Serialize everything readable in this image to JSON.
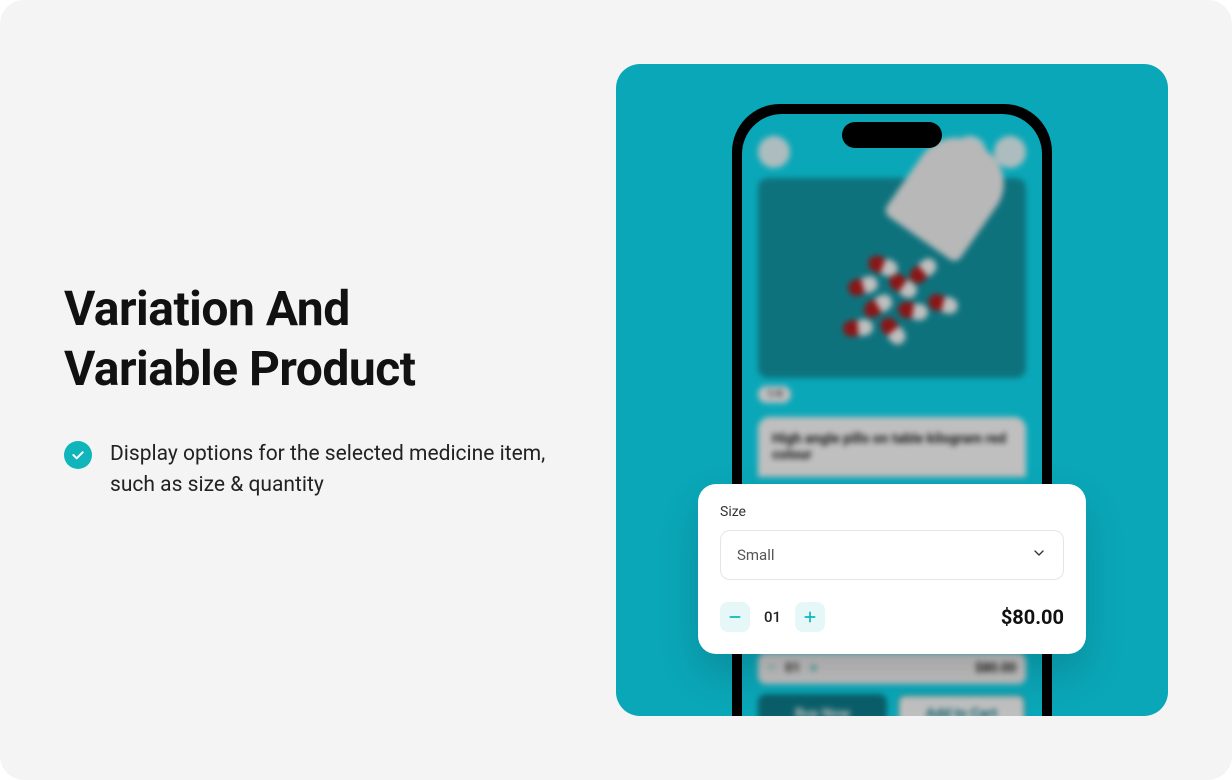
{
  "heading": {
    "line1": "Variation And",
    "line2": "Variable Product"
  },
  "bullet": {
    "text": "Display options for the selected medicine item, such as size & quantity"
  },
  "phone": {
    "product_title": "High angle pills on table kilogram red colour",
    "chip_label": "1/4",
    "bg_qty": "01",
    "bg_price": "$80.00",
    "buy_now": "Buy Now",
    "add_to_cart": "Add to Cart"
  },
  "card": {
    "size_label": "Size",
    "size_value": "Small",
    "quantity": "01",
    "price": "$80.00"
  },
  "colors": {
    "accent": "#0fb5bb",
    "panel_bg": "#0aa7b8"
  }
}
